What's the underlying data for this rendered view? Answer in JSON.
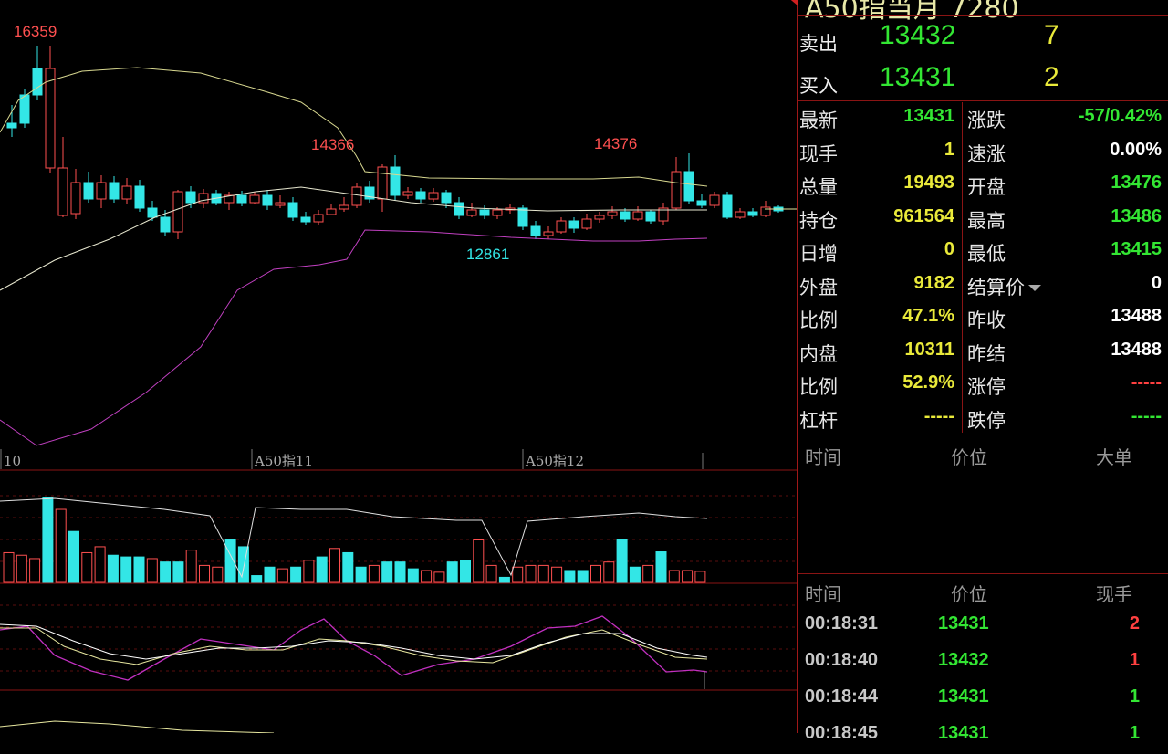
{
  "title": "A50指当月 7280",
  "colors": {
    "up": "#ff5050",
    "down": "#33e6e6",
    "green": "#33e633",
    "yellow": "#eaea3a",
    "white": "#ffffff",
    "red": "#ff4040",
    "grid": "#8a1414"
  },
  "chart": {
    "peak_labels": [
      {
        "text": "16359",
        "color": "#ff5050"
      },
      {
        "text": "14366",
        "color": "#ff5050"
      },
      {
        "text": "14376",
        "color": "#ff5050"
      },
      {
        "text": "12861",
        "color": "#33e6e6"
      }
    ],
    "month_labels": [
      "10",
      "A50指11",
      "A50指12"
    ]
  },
  "quote": {
    "sell": {
      "label": "卖出",
      "price": "13432",
      "volume": "7"
    },
    "buy": {
      "label": "买入",
      "price": "13431",
      "volume": "2"
    }
  },
  "stats_left": [
    {
      "label": "最新",
      "value": "13431",
      "color": "green"
    },
    {
      "label": "现手",
      "value": "1",
      "color": "yellow"
    },
    {
      "label": "总量",
      "value": "19493",
      "color": "yellow"
    },
    {
      "label": "持仓",
      "value": "961564",
      "color": "yellow"
    },
    {
      "label": "日增",
      "value": "0",
      "color": "yellow"
    },
    {
      "label": "外盘",
      "value": "9182",
      "color": "yellow"
    },
    {
      "label": "比例",
      "value": "47.1%",
      "color": "yellow"
    },
    {
      "label": "内盘",
      "value": "10311",
      "color": "yellow"
    },
    {
      "label": "比例",
      "value": "52.9%",
      "color": "yellow"
    },
    {
      "label": "杠杆",
      "value": "-----",
      "color": "yellow"
    }
  ],
  "stats_right": [
    {
      "label": "涨跌",
      "value": "-57/0.42%",
      "color": "green"
    },
    {
      "label": "速涨",
      "value": "0.00%",
      "color": "white"
    },
    {
      "label": "开盘",
      "value": "13476",
      "color": "green"
    },
    {
      "label": "最高",
      "value": "13486",
      "color": "green"
    },
    {
      "label": "最低",
      "value": "13415",
      "color": "green"
    },
    {
      "label": "结算价",
      "value": "0",
      "color": "white",
      "dropdown": true
    },
    {
      "label": "昨收",
      "value": "13488",
      "color": "white"
    },
    {
      "label": "昨结",
      "value": "13488",
      "color": "white"
    },
    {
      "label": "涨停",
      "value": "-----",
      "color": "red"
    },
    {
      "label": "跌停",
      "value": "-----",
      "color": "green"
    }
  ],
  "big_orders": {
    "headers": [
      "时间",
      "价位",
      "大单"
    ]
  },
  "ticks": {
    "headers": [
      "时间",
      "价位",
      "现手"
    ],
    "rows": [
      {
        "time": "00:18:31",
        "price": "13431",
        "vol": "2",
        "vol_color": "red"
      },
      {
        "time": "00:18:40",
        "price": "13432",
        "vol": "1",
        "vol_color": "red"
      },
      {
        "time": "00:18:44",
        "price": "13431",
        "vol": "1",
        "vol_color": "green"
      },
      {
        "time": "00:18:45",
        "price": "13431",
        "vol": "1",
        "vol_color": "green"
      }
    ]
  }
}
